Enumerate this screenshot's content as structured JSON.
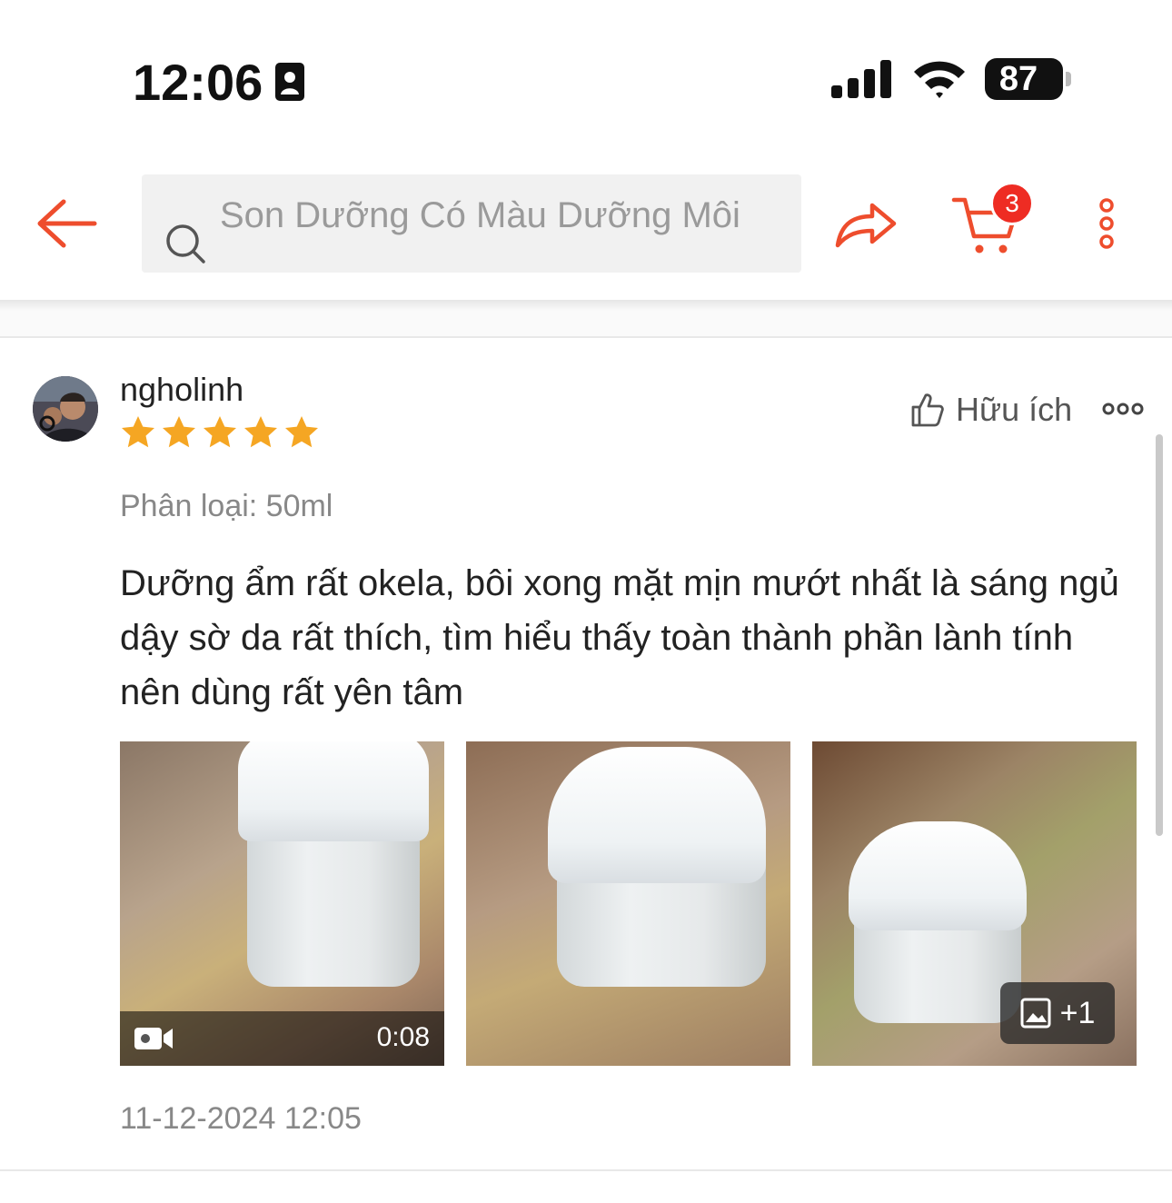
{
  "status_bar": {
    "time": "12:06",
    "battery": "87"
  },
  "header": {
    "search_placeholder": "Son Dưỡng Có Màu Dưỡng Môi",
    "cart_count": "3",
    "accent_color": "#ee4d2d"
  },
  "review": {
    "username": "ngholinh",
    "rating": 5,
    "rating_max": 5,
    "helpful_label": "Hữu ích",
    "variation": "Phân loại: 50ml",
    "comment": "Dưỡng ẩm rất okela, bôi xong mặt mịn mướt nhất là sáng ngủ dậy sờ da rất thích, tìm hiểu thấy toàn thành phần lành tính nên dùng rất yên tâm",
    "video_duration": "0:08",
    "more_media": "+1",
    "timestamp": "11-12-2024 12:05"
  }
}
